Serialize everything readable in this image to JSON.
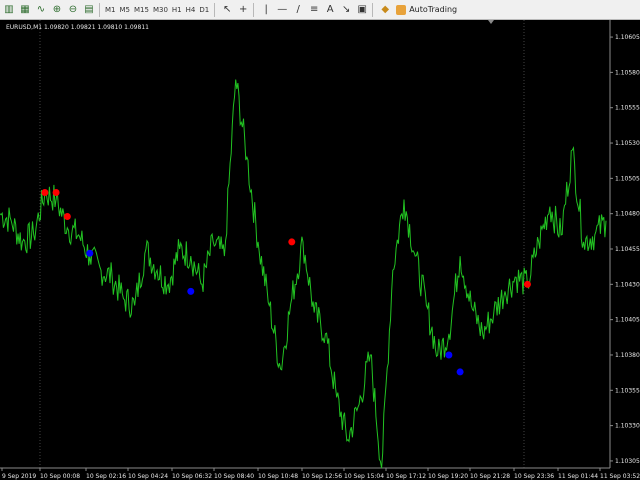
{
  "toolbar": {
    "timeframes": [
      "M1",
      "M5",
      "M15",
      "M30",
      "H1",
      "H4",
      "D1"
    ],
    "autotrading_label": "AutoTrading"
  },
  "chart": {
    "symbol_info": "EURUSD,M1 1.09820 1.09821 1.09810 1.09811"
  },
  "colors": {
    "background": "#000000",
    "price_line": "#22c322",
    "buy_marker": "#ff0000",
    "sell_marker": "#0000ff",
    "axis_text": "#e8e8e8",
    "grid_line": "#6f6f6f"
  },
  "chart_data": {
    "type": "line",
    "y_axis_ticks": [
      "1.10605",
      "1.10580",
      "1.10555",
      "1.10530",
      "1.10505",
      "1.10480",
      "1.10455",
      "1.10430",
      "1.10405",
      "1.10380",
      "1.10355",
      "1.10330",
      "1.10305"
    ],
    "x_axis_ticks": [
      "9 Sep 2019",
      "10 Sep 00:08",
      "10 Sep 02:16",
      "10 Sep 04:24",
      "10 Sep 06:32",
      "10 Sep 08:40",
      "10 Sep 10:48",
      "10 Sep 12:56",
      "10 Sep 15:04",
      "10 Sep 17:12",
      "10 Sep 19:20",
      "10 Sep 21:28",
      "10 Sep 23:36",
      "11 Sep 01:44",
      "11 Sep 03:52"
    ],
    "ylim": [
      1.103,
      1.1061
    ],
    "series": [
      {
        "values": [
          1.1048,
          1.10475,
          1.1046,
          1.10465,
          1.10495,
          1.1049,
          1.1047,
          1.10465,
          1.1045,
          1.1044,
          1.10435,
          1.1042,
          1.10415,
          1.10455,
          1.1044,
          1.1043,
          1.10455,
          1.1045,
          1.1043,
          1.1046,
          1.1045,
          1.10575,
          1.1052,
          1.1046,
          1.10415,
          1.1037,
          1.1042,
          1.1046,
          1.1041,
          1.10395,
          1.1035,
          1.1032,
          1.10345,
          1.1038,
          1.103,
          1.1044,
          1.1049,
          1.1045,
          1.10415,
          1.1038,
          1.10395,
          1.1045,
          1.10415,
          1.10395,
          1.1041,
          1.10425,
          1.10435,
          1.1043,
          1.1046,
          1.10485,
          1.10465,
          1.10525,
          1.1046,
          1.10465,
          1.10475
        ]
      }
    ],
    "buy_signals": [
      {
        "x_index": 4,
        "y": 1.10495
      },
      {
        "x_index": 5,
        "y": 1.10495
      },
      {
        "x_index": 6,
        "y": 1.10478
      },
      {
        "x_index": 26,
        "y": 1.1046
      },
      {
        "x_index": 47,
        "y": 1.1043
      }
    ],
    "sell_signals": [
      {
        "x_index": 8,
        "y": 1.10452
      },
      {
        "x_index": 17,
        "y": 1.10425
      },
      {
        "x_index": 40,
        "y": 1.1038
      },
      {
        "x_index": 41,
        "y": 1.10368
      }
    ]
  }
}
